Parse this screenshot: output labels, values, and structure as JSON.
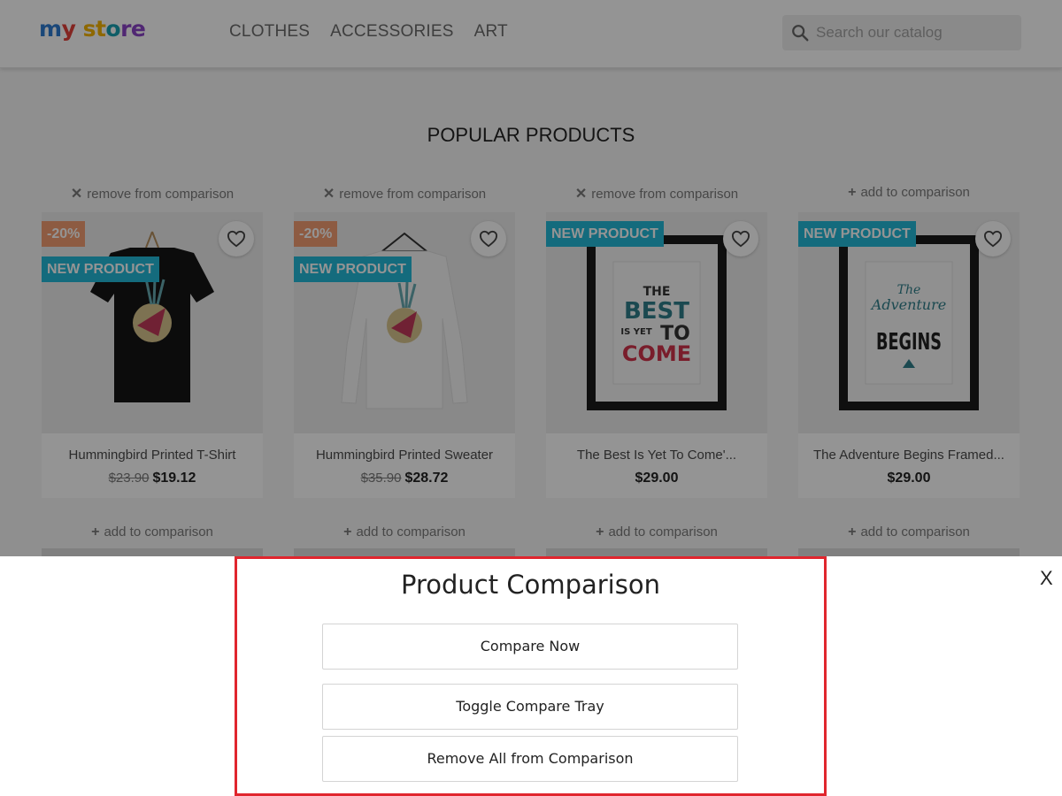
{
  "header": {
    "logo_parts": [
      "m",
      "y ",
      "st",
      "o",
      "re"
    ],
    "nav": [
      "CLOTHES",
      "ACCESSORIES",
      "ART"
    ],
    "search_placeholder": "Search our catalog"
  },
  "section_title": "POPULAR PRODUCTS",
  "products": [
    {
      "top_link": {
        "symbol": "✕",
        "label": "remove from comparison"
      },
      "discount": "-20%",
      "badge": "NEW PRODUCT",
      "name": "Hummingbird Printed T-Shirt",
      "old_price": "$23.90",
      "price": "$19.12",
      "bottom_link": {
        "symbol": "+",
        "label": "add to comparison"
      }
    },
    {
      "top_link": {
        "symbol": "✕",
        "label": "remove from comparison"
      },
      "discount": "-20%",
      "badge": "NEW PRODUCT",
      "name": "Hummingbird Printed Sweater",
      "old_price": "$35.90",
      "price": "$28.72",
      "bottom_link": {
        "symbol": "+",
        "label": "add to comparison"
      }
    },
    {
      "top_link": {
        "symbol": "✕",
        "label": "remove from comparison"
      },
      "badge": "NEW PRODUCT",
      "name": "The Best Is Yet To Come'...",
      "price": "$29.00",
      "poster_lines": [
        "THE",
        "BEST",
        "IS YET",
        "TO",
        "COME"
      ],
      "bottom_link": {
        "symbol": "+",
        "label": "add to comparison"
      }
    },
    {
      "top_link": {
        "symbol": "+",
        "label": "add to comparison"
      },
      "badge": "NEW PRODUCT",
      "name": "The Adventure Begins Framed...",
      "price": "$29.00",
      "poster_lines": [
        "The",
        "Adventure",
        "BEGINS"
      ],
      "bottom_link": {
        "symbol": "+",
        "label": "add to comparison"
      }
    }
  ],
  "comparison_panel": {
    "title": "Product Comparison",
    "buttons": [
      "Compare Now",
      "Toggle Compare Tray",
      "Remove All from Comparison"
    ],
    "close_label": "X"
  },
  "colors": {
    "accent_badge": "#24b9d7",
    "discount_badge": "#f39d72",
    "panel_border": "#e0262e"
  }
}
